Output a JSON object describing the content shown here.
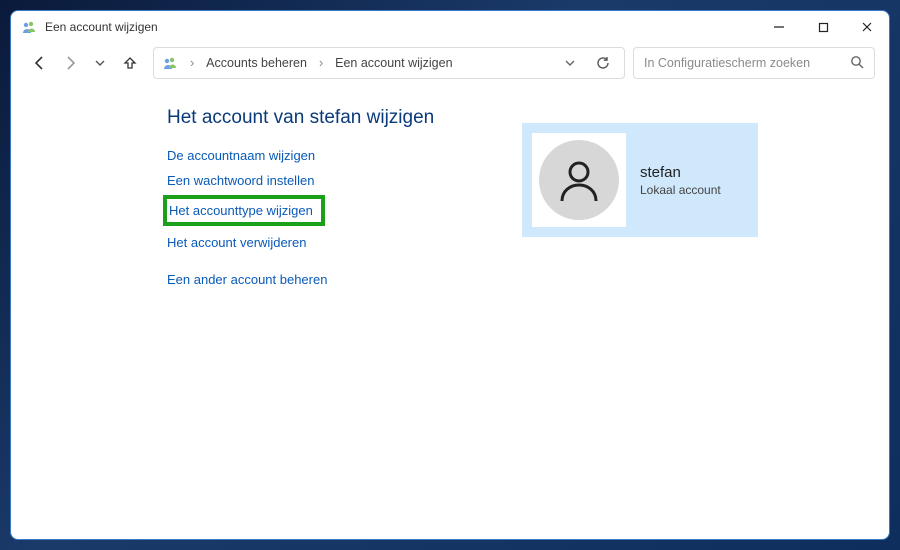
{
  "window": {
    "title": "Een account wijzigen"
  },
  "breadcrumb": {
    "item1": "Accounts beheren",
    "item2": "Een account wijzigen"
  },
  "search": {
    "placeholder": "In Configuratiescherm zoeken"
  },
  "page": {
    "title": "Het account van stefan wijzigen",
    "links": {
      "change_name": "De accountnaam wijzigen",
      "set_password": "Een wachtwoord instellen",
      "change_type": "Het accounttype wijzigen",
      "delete_account": "Het account verwijderen",
      "manage_other": "Een ander account beheren"
    }
  },
  "account": {
    "name": "stefan",
    "type": "Lokaal account"
  }
}
